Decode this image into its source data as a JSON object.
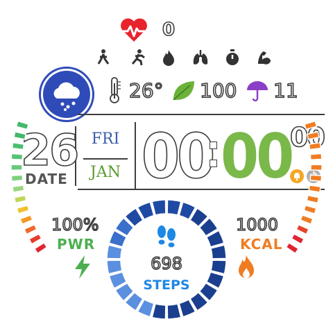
{
  "heart_rate": {
    "value": "0",
    "icon": "heart-pulse-icon",
    "color": "#e8232b"
  },
  "activity_icons": [
    "walking-icon",
    "running-icon",
    "fire-icon",
    "lungs-icon",
    "stopwatch-icon",
    "muscle-icon"
  ],
  "weather": {
    "icon": "cloud-rain-icon",
    "badge_color": "#2f4bb8",
    "temperature": "26°",
    "air_quality": "100",
    "rain_chance": "11",
    "thermometer_icon": "thermometer-icon",
    "leaf_icon": "leaf-icon",
    "umbrella_icon": "umbrella-icon"
  },
  "date": {
    "day": "26",
    "label": "DATE",
    "weekday": "FRI",
    "month": "JAN"
  },
  "time": {
    "hours": "00",
    "minutes": "00",
    "seconds": "00",
    "minutes_color": "#7ab84a"
  },
  "status_icons": [
    "alarm-bell-icon",
    "bluetooth-icon"
  ],
  "power": {
    "value": "100%",
    "label": "PWR",
    "level": 1.0
  },
  "calories": {
    "value": "1000",
    "label": "KCAL",
    "level": 1.0
  },
  "steps": {
    "value": "698",
    "label": "STEPS",
    "ring_segments": 24,
    "ring_progress": 0.29
  }
}
